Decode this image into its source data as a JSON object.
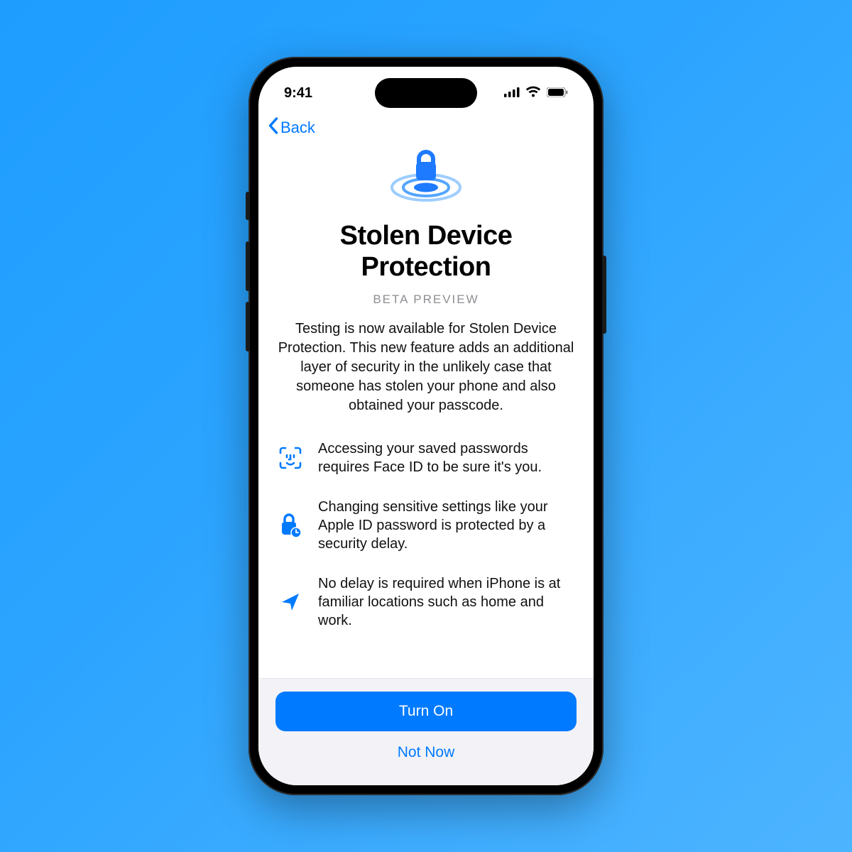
{
  "status": {
    "time": "9:41"
  },
  "nav": {
    "back_label": "Back"
  },
  "page": {
    "title": "Stolen Device Protection",
    "subtitle": "BETA PREVIEW",
    "paragraph": "Testing is now available for Stolen Device Protection. This new feature adds an additional layer of security in the unlikely case that someone has stolen your phone and also obtained your passcode."
  },
  "features": [
    {
      "icon": "faceid-icon",
      "text": "Accessing your saved passwords requires Face ID to be sure it's you."
    },
    {
      "icon": "lockdelay-icon",
      "text": "Changing sensitive settings like your Apple ID password is protected by a security delay."
    },
    {
      "icon": "location-icon",
      "text": "No delay is required when iPhone is at familiar locations such as home and work."
    }
  ],
  "buttons": {
    "primary": "Turn On",
    "secondary": "Not Now"
  },
  "colors": {
    "accent": "#007aff"
  }
}
